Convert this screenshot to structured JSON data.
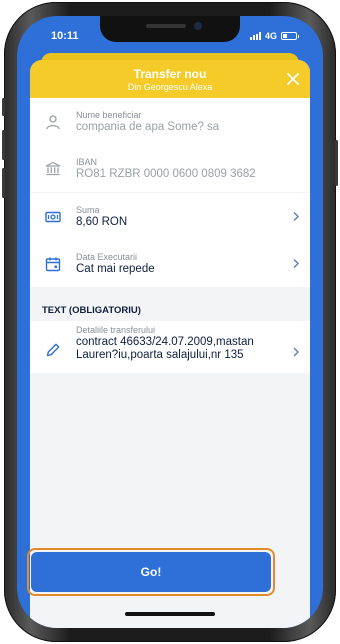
{
  "status_bar": {
    "time": "10:11",
    "network": "4G"
  },
  "header": {
    "title": "Transfer nou",
    "subtitle": "Din Georgescu Alexa",
    "close_icon": "close-icon"
  },
  "fields": {
    "beneficiar": {
      "label": "Nume beneficiar",
      "value": "compania de apa  Some? sa",
      "icon": "person-icon"
    },
    "iban": {
      "label": "IBAN",
      "value": "RO81 RZBR 0000 0600 0809 3682",
      "icon": "bank-icon"
    },
    "suma": {
      "label": "Suma",
      "value": "8,60 RON",
      "icon": "money-icon"
    },
    "data": {
      "label": "Data Executarii",
      "value": "Cat mai repede",
      "icon": "calendar-icon"
    }
  },
  "text_section": {
    "title": "TEXT (OBLIGATORIU)",
    "details": {
      "label": "Detaliile transferului",
      "line1": "contract 46633/24.07.2009,mastan",
      "line2": "Lauren?iu,poarta salajului,nr 135",
      "icon": "pencil-icon"
    }
  },
  "go_button": {
    "label": "Go!"
  },
  "colors": {
    "accent_yellow": "#F4CB28",
    "primary_blue": "#2F6FD8",
    "highlight_orange": "#E58A2A"
  }
}
